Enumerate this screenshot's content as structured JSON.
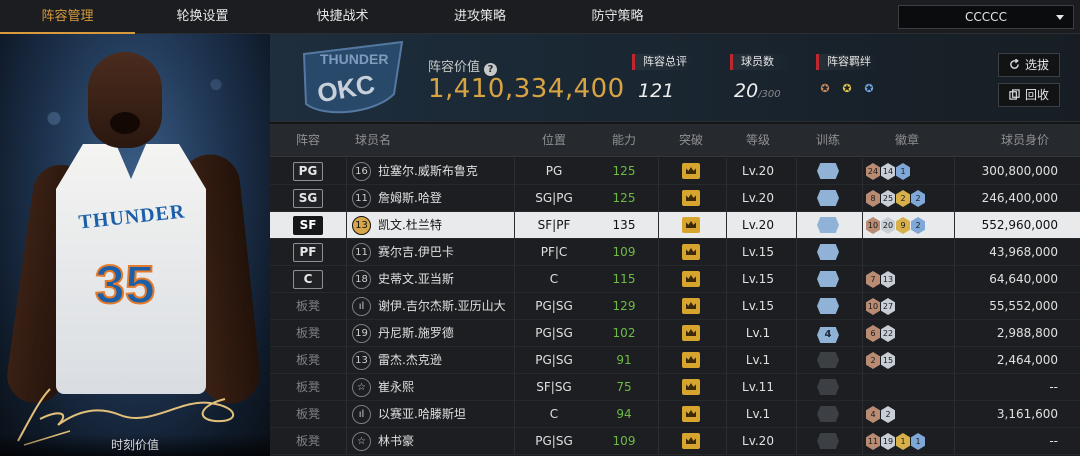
{
  "tabs": [
    {
      "label": "阵容管理",
      "active": true
    },
    {
      "label": "轮换设置",
      "active": false
    },
    {
      "label": "快捷战术",
      "active": false
    },
    {
      "label": "进攻策略",
      "active": false
    },
    {
      "label": "防守策略",
      "active": false
    }
  ],
  "team_selector": {
    "value": "CCCCC"
  },
  "player_card": {
    "jersey_team": "THUNDER",
    "jersey_number": "35",
    "moment_value_label": "时刻价值"
  },
  "summary": {
    "value_label": "阵容价值",
    "value": "1,410,334,400",
    "overall_label": "阵容总评",
    "overall": "121",
    "players_label": "球员数",
    "players_count": "20",
    "players_max": "/300",
    "chemistry_label": "阵容羁绊",
    "select_button": "选拔",
    "return_button": "回收"
  },
  "table": {
    "headers": [
      "阵容",
      "球员名",
      "位置",
      "能力",
      "突破",
      "等级",
      "训练",
      "徽章",
      "球员身价"
    ],
    "rows": [
      {
        "slot": "PG",
        "starter": true,
        "num": "16",
        "name": "拉塞尔.威斯布鲁克",
        "position": "PG",
        "ability": "125",
        "level": "Lv.20",
        "train": "",
        "badges": [
          [
            "br",
            "24"
          ],
          [
            "si",
            "14"
          ],
          [
            "bl",
            "1"
          ]
        ],
        "price": "300,800,000",
        "selected": false
      },
      {
        "slot": "SG",
        "starter": true,
        "num": "11",
        "name": "詹姆斯.哈登",
        "position": "SG|PG",
        "ability": "125",
        "level": "Lv.20",
        "train": "",
        "badges": [
          [
            "br",
            "8"
          ],
          [
            "si",
            "25"
          ],
          [
            "go",
            "2"
          ],
          [
            "bl",
            "2"
          ]
        ],
        "price": "246,400,000",
        "selected": false
      },
      {
        "slot": "SF",
        "starter": true,
        "num": "13",
        "name": "凯文.杜兰特",
        "position": "SF|PF",
        "ability": "135",
        "level": "Lv.20",
        "train": "",
        "badges": [
          [
            "br",
            "10"
          ],
          [
            "si",
            "20"
          ],
          [
            "go",
            "9"
          ],
          [
            "bl",
            "2"
          ]
        ],
        "price": "552,960,000",
        "selected": true
      },
      {
        "slot": "PF",
        "starter": true,
        "num": "11",
        "name": "赛尔吉.伊巴卡",
        "position": "PF|C",
        "ability": "109",
        "level": "Lv.15",
        "train": "",
        "badges": [],
        "price": "43,968,000",
        "selected": false
      },
      {
        "slot": "C",
        "starter": true,
        "num": "18",
        "name": "史蒂文.亚当斯",
        "position": "C",
        "ability": "115",
        "level": "Lv.15",
        "train": "",
        "badges": [
          [
            "br",
            "7"
          ],
          [
            "si",
            "13"
          ]
        ],
        "price": "64,640,000",
        "selected": false
      },
      {
        "slot": "板凳",
        "starter": false,
        "num": "ıl",
        "name": "谢伊.吉尔杰斯.亚历山大",
        "position": "PG|SG",
        "ability": "129",
        "level": "Lv.15",
        "train": "",
        "badges": [
          [
            "br",
            "10"
          ],
          [
            "si",
            "27"
          ]
        ],
        "price": "55,552,000",
        "selected": false
      },
      {
        "slot": "板凳",
        "starter": false,
        "num": "19",
        "name": "丹尼斯.施罗德",
        "position": "PG|SG",
        "ability": "102",
        "level": "Lv.1",
        "train": "4",
        "badges": [
          [
            "br",
            "6"
          ],
          [
            "si",
            "22"
          ]
        ],
        "price": "2,988,800",
        "selected": false
      },
      {
        "slot": "板凳",
        "starter": false,
        "num": "13",
        "name": "雷杰.杰克逊",
        "position": "PG|SG",
        "ability": "91",
        "level": "Lv.1",
        "train": "off",
        "badges": [
          [
            "br",
            "2"
          ],
          [
            "si",
            "15"
          ]
        ],
        "price": "2,464,000",
        "selected": false
      },
      {
        "slot": "板凳",
        "starter": false,
        "num": "☆",
        "name": "崔永熙",
        "position": "SF|SG",
        "ability": "75",
        "level": "Lv.11",
        "train": "off",
        "badges": [],
        "price": "--",
        "selected": false
      },
      {
        "slot": "板凳",
        "starter": false,
        "num": "ıl",
        "name": "以赛亚.哈滕斯坦",
        "position": "C",
        "ability": "94",
        "level": "Lv.1",
        "train": "off",
        "badges": [
          [
            "br",
            "4"
          ],
          [
            "si",
            "2"
          ]
        ],
        "price": "3,161,600",
        "selected": false
      },
      {
        "slot": "板凳",
        "starter": false,
        "num": "☆",
        "name": "林书豪",
        "position": "PG|SG",
        "ability": "109",
        "level": "Lv.20",
        "train": "off",
        "badges": [
          [
            "br",
            "11"
          ],
          [
            "si",
            "19"
          ],
          [
            "go",
            "1"
          ],
          [
            "bl",
            "1"
          ]
        ],
        "price": "--",
        "selected": false
      }
    ]
  },
  "colors": {
    "accent": "#d79a3c",
    "value_gold": "#d8a343",
    "ability_green": "#6fba45",
    "selected_row": "#e9eaec"
  }
}
